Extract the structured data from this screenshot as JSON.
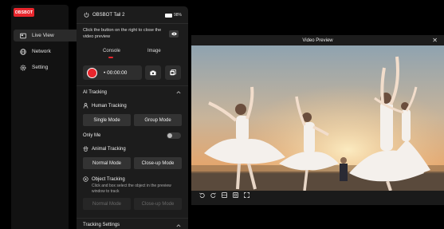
{
  "app": {
    "logo_text": "OBSBOT"
  },
  "sidebar": {
    "items": [
      {
        "label": "Live View",
        "icon": "live-view-icon",
        "active": true
      },
      {
        "label": "Network",
        "icon": "globe-icon",
        "active": false
      },
      {
        "label": "Setting",
        "icon": "gear-icon",
        "active": false
      }
    ]
  },
  "device": {
    "name": "OBSBOT Tail 2",
    "battery": "98%"
  },
  "preview_hint": "Click the button on the right to close the video preview",
  "tabs": [
    {
      "label": "Console",
      "active": true
    },
    {
      "label": "Image",
      "active": false
    }
  ],
  "recording": {
    "time": "00:00:00"
  },
  "ai_tracking": {
    "title": "AI Tracking",
    "human_title": "Human Tracking",
    "human_modes": [
      "Single Mode",
      "Group Mode"
    ],
    "only_me": "Only Me",
    "animal_title": "Animal Tracking",
    "animal_modes": [
      "Normal Mode",
      "Close-up Mode"
    ],
    "object_title": "Object Tracking",
    "object_hint": "Click and box select the object in the preview window to track",
    "object_modes": [
      "Normal Mode",
      "Close-up Mode"
    ]
  },
  "tracking_settings": {
    "title": "Tracking Settings"
  },
  "video": {
    "title": "Video Preview"
  },
  "colors": {
    "accent": "#e8262d",
    "panel": "#1c1c1c",
    "sidebar": "#121212"
  }
}
